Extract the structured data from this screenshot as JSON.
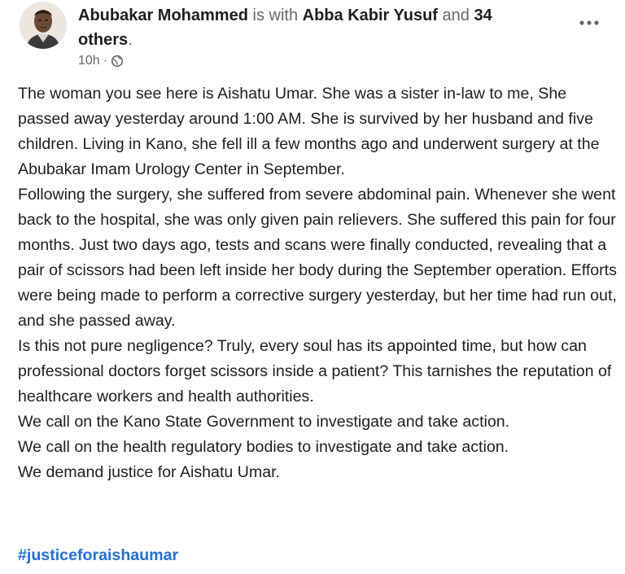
{
  "post": {
    "author": "Abubakar Mohammed",
    "with_text": "is with",
    "tagged_person": "Abba Kabir Yusuf",
    "and_text": "and",
    "others": "34 others",
    "period": ".",
    "time": "10h",
    "time_separator": "·",
    "privacy_icon": "globe-icon",
    "more_icon": "more-horizontal-icon",
    "paragraphs": [
      "The woman you see here is Aishatu Umar. She was a sister in-law to me, She passed away yesterday around 1:00 AM. She is survived by her husband and five children. Living in Kano, she fell ill a few months ago and underwent surgery at the Abubakar Imam Urology Center in September.",
      "Following the surgery, she suffered from severe abdominal pain. Whenever she went back to the hospital, she was only given pain relievers. She suffered this pain for four months. Just two days ago, tests and scans were finally conducted, revealing that a pair of scissors had been left inside her body during the September operation. Efforts were being made to perform a corrective surgery yesterday, but her time had run out, and she passed away.",
      "Is this not pure negligence? Truly, every soul has its appointed time, but how can professional doctors forget scissors inside a patient? This tarnishes the reputation of healthcare workers and health authorities.",
      "We call on the Kano State Government to investigate and take action.",
      "We call on the health regulatory bodies to investigate and take action.",
      "We demand justice for Aishatu Umar."
    ],
    "hashtag": "#justiceforaishaumar"
  },
  "colors": {
    "text": "#1c1e21",
    "secondary": "#65676b",
    "link": "#216fdb"
  }
}
